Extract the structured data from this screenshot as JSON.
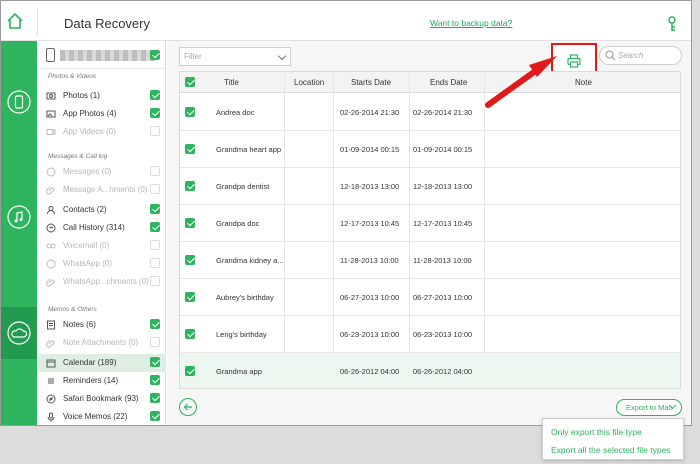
{
  "app": {
    "title": "Data Recovery",
    "backup_link": "Want to backup data?"
  },
  "colors": {
    "accent": "#2eb45f",
    "highlight": "#e01a1a"
  },
  "sidebar": {
    "sections": [
      {
        "label": "Photos & Videos"
      },
      {
        "label": "Messages & Call log"
      },
      {
        "label": "Memos & Others"
      }
    ],
    "items": [
      {
        "label": "Photos (1)",
        "icon": "photo-icon",
        "checked": true,
        "enabled": true
      },
      {
        "label": "App Photos (4)",
        "icon": "app-photo-icon",
        "checked": true,
        "enabled": true
      },
      {
        "label": "App Videos (0)",
        "icon": "video-icon",
        "checked": false,
        "enabled": false
      },
      {
        "label": "Messages (0)",
        "icon": "message-icon",
        "checked": false,
        "enabled": false
      },
      {
        "label": "Message A...hments (0)",
        "icon": "attachment-icon",
        "checked": false,
        "enabled": false
      },
      {
        "label": "Contacts (2)",
        "icon": "contacts-icon",
        "checked": true,
        "enabled": true
      },
      {
        "label": "Call History (314)",
        "icon": "phone-icon",
        "checked": true,
        "enabled": true
      },
      {
        "label": "Voicemail (0)",
        "icon": "voicemail-icon",
        "checked": false,
        "enabled": false
      },
      {
        "label": "WhatsApp (0)",
        "icon": "whatsapp-icon",
        "checked": false,
        "enabled": false
      },
      {
        "label": "WhatsApp...chments (0)",
        "icon": "attachment-icon",
        "checked": false,
        "enabled": false
      },
      {
        "label": "Notes (6)",
        "icon": "notes-icon",
        "checked": true,
        "enabled": true
      },
      {
        "label": "Note Attachments (0)",
        "icon": "attachment-icon",
        "checked": false,
        "enabled": false
      },
      {
        "label": "Calendar (189)",
        "icon": "calendar-icon",
        "checked": true,
        "enabled": true,
        "selected": true
      },
      {
        "label": "Reminders (14)",
        "icon": "reminders-icon",
        "checked": true,
        "enabled": true
      },
      {
        "label": "Safari Bookmark (93)",
        "icon": "safari-icon",
        "checked": true,
        "enabled": true
      },
      {
        "label": "Voice Memos (22)",
        "icon": "mic-icon",
        "checked": true,
        "enabled": true
      }
    ]
  },
  "toolbar": {
    "filter_placeholder": "Filter",
    "search_placeholder": "Search"
  },
  "table": {
    "headers": [
      "Title",
      "Location",
      "Starts Date",
      "Ends Date",
      "Note"
    ],
    "rows": [
      {
        "title": "Andrea doc",
        "location": "",
        "start": "02-26-2014 21:30",
        "end": "02-26-2014 21:30",
        "note": ""
      },
      {
        "title": "Grandma heart app",
        "location": "",
        "start": "01-09-2014 00:15",
        "end": "01-09-2014 00:15",
        "note": ""
      },
      {
        "title": "Grandpa dentist",
        "location": "",
        "start": "12-18-2013 13:00",
        "end": "12-18-2013 13:00",
        "note": ""
      },
      {
        "title": "Grandpa doc",
        "location": "",
        "start": "12-17-2013 10:45",
        "end": "12-17-2013 10:45",
        "note": ""
      },
      {
        "title": "Grandma kidney a...",
        "location": "",
        "start": "11-28-2013 10:00",
        "end": "11-28-2013 10:00",
        "note": ""
      },
      {
        "title": "Aubrey's birthday",
        "location": "",
        "start": "06-27-2013 10:00",
        "end": "06-27-2013 10:00",
        "note": ""
      },
      {
        "title": "Leng's birthday",
        "location": "",
        "start": "06-23-2013 10:00",
        "end": "06-23-2013 10:00",
        "note": ""
      },
      {
        "title": "Grandma app",
        "location": "",
        "start": "06-26-2012 04:00",
        "end": "06-26-2012 04:00",
        "note": ""
      }
    ]
  },
  "export": {
    "button_label": "Export to Mac",
    "menu": [
      "Only export this file type",
      "Export all the selected file types"
    ]
  }
}
